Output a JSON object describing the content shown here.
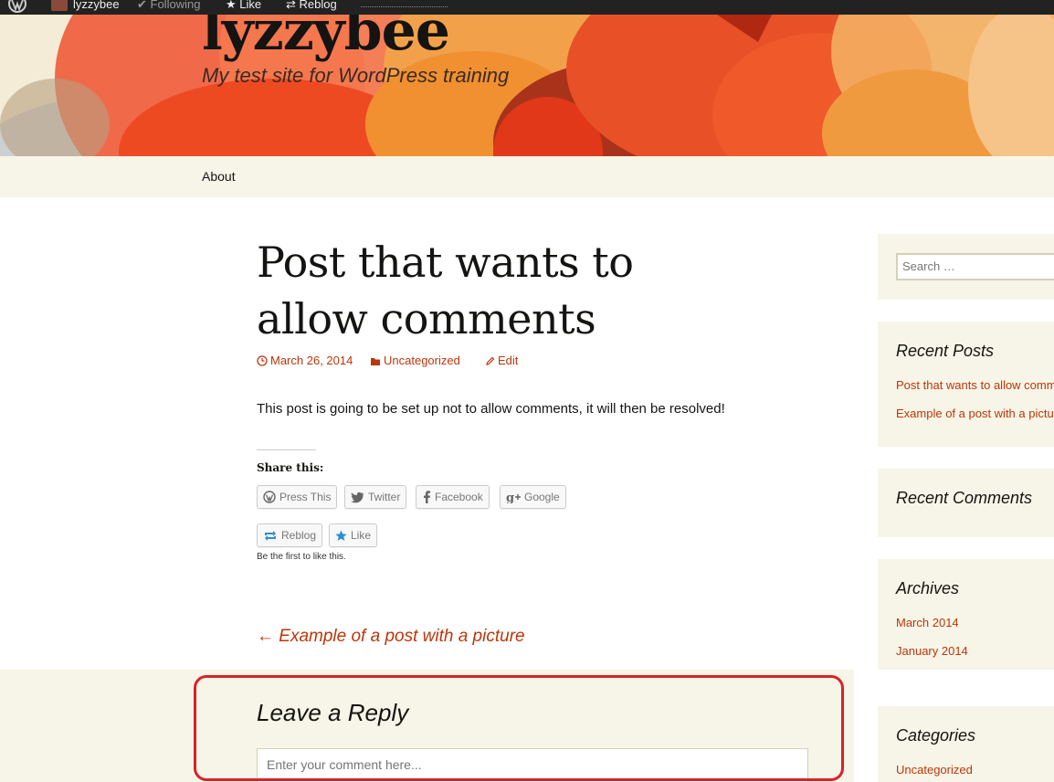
{
  "adminbar": {
    "site_name": "lyzzybee",
    "following": "Following",
    "like": "Like",
    "reblog": "Reblog"
  },
  "header": {
    "site_title": "lyzzybee",
    "site_description": "My test site for WordPress training"
  },
  "nav": {
    "items": [
      {
        "label": "About"
      }
    ]
  },
  "post": {
    "title_line1": "Post that wants to",
    "title_line2": "allow comments",
    "date": "March 26, 2014",
    "category": "Uncategorized",
    "edit": "Edit",
    "content": "This post is going to be set up not to allow comments, it will then be resolved!"
  },
  "sharing": {
    "title": "Share this:",
    "buttons": [
      {
        "label": "Press This",
        "icon": "wordpress-icon"
      },
      {
        "label": "Twitter",
        "icon": "twitter-icon"
      },
      {
        "label": "Facebook",
        "icon": "facebook-icon"
      },
      {
        "label": "Google",
        "icon": "google-plus-icon"
      }
    ],
    "reblog": "Reblog",
    "like": "Like",
    "be_first": "Be the first to like this."
  },
  "navigation": {
    "previous_post": "← Example of a post with a picture"
  },
  "reply": {
    "title": "Leave a Reply",
    "placeholder": "Enter your comment here..."
  },
  "sidebar": {
    "search_placeholder": "Search …",
    "recent_posts_title": "Recent Posts",
    "recent_posts": [
      "Post that wants to allow comments",
      "Example of a post with a picture"
    ],
    "recent_comments_title": "Recent Comments",
    "archives_title": "Archives",
    "archives": [
      "March 2014",
      "January 2014"
    ],
    "categories_title": "Categories",
    "categories": [
      "Uncategorized"
    ]
  },
  "colors": {
    "accent": "#bc360a",
    "highlight": "#d8232a",
    "adminbar": "#222222",
    "panel": "#f7f5e7"
  }
}
